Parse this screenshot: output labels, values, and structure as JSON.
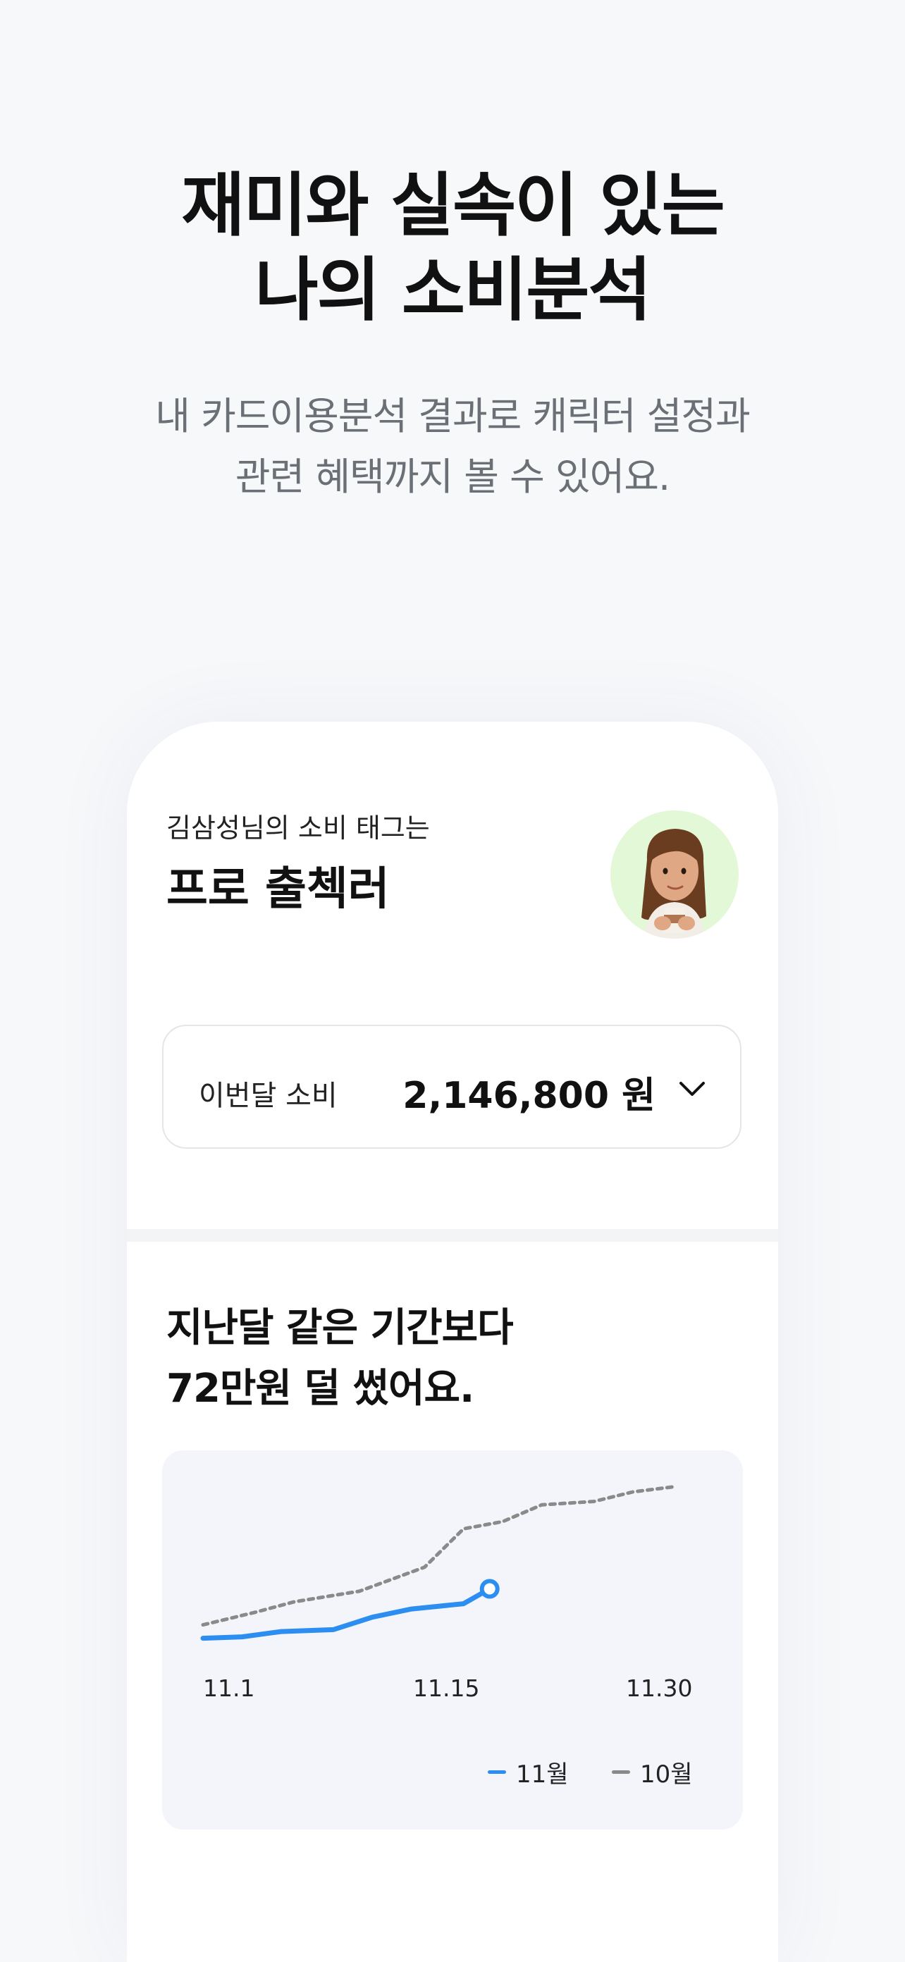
{
  "hero": {
    "title_line1": "재미와 실속이 있는",
    "title_line2": "나의 소비분석",
    "subtitle_line1": "내 카드이용분석 결과로 캐릭터 설정과",
    "subtitle_line2": "관련 혜택까지 볼 수 있어요."
  },
  "profile": {
    "tag_label": "김삼성님의 소비 태그는",
    "tag_name": "프로 출첵러",
    "avatar_icon": "character-avatar-icon"
  },
  "spending": {
    "label": "이번달 소비",
    "amount": "2,146,800 원"
  },
  "comparison": {
    "title_line1": "지난달 같은 기간보다",
    "title_line2": "72만원 덜 썼어요."
  },
  "colors": {
    "current": "#2b8ef0",
    "previous": "#8a8a8a",
    "chart_bg": "#f3f5fa"
  },
  "chart_data": {
    "type": "line",
    "x_ticks": [
      "11.1",
      "11.15",
      "11.30"
    ],
    "series": [
      {
        "name": "11월",
        "style": "solid",
        "color": "#2b8ef0",
        "points": [
          [
            1,
            0.2
          ],
          [
            2.5,
            0.5
          ],
          [
            4,
            1.6
          ],
          [
            6,
            2
          ],
          [
            7.5,
            4.6
          ],
          [
            9,
            6.3
          ],
          [
            11,
            7.4
          ],
          [
            12,
            10.5
          ]
        ]
      },
      {
        "name": "10월",
        "style": "dotted",
        "color": "#8a8a8a",
        "points": [
          [
            1,
            3
          ],
          [
            3,
            5.6
          ],
          [
            4.5,
            7.8
          ],
          [
            7,
            10
          ],
          [
            9.5,
            15
          ],
          [
            11,
            23
          ],
          [
            12.5,
            24.5
          ],
          [
            14,
            28
          ],
          [
            16,
            28.7
          ],
          [
            17.5,
            30.7
          ],
          [
            19,
            31.7
          ]
        ]
      }
    ],
    "xlim": [
      1,
      19.5
    ],
    "ylim": [
      0,
      32
    ],
    "grid": false,
    "legend": "bottom-right"
  }
}
